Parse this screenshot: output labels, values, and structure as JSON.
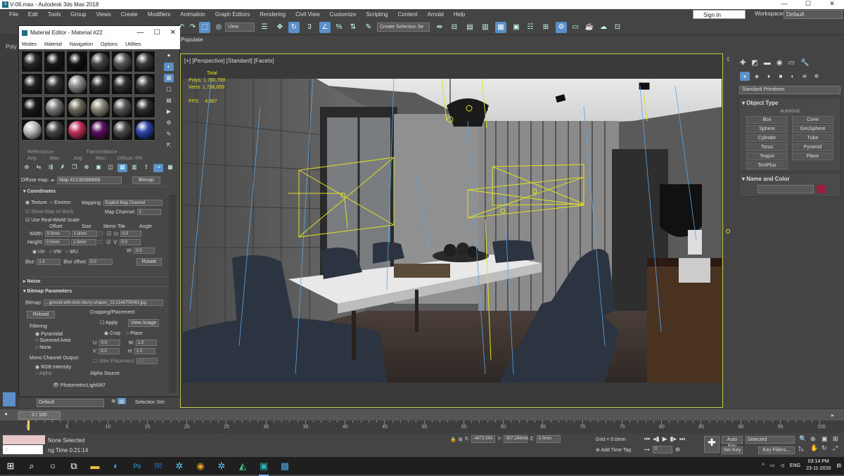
{
  "window": {
    "title": "V-06.max - Autodesk 3ds Max 2018",
    "controls": [
      "—",
      "☐",
      "✕"
    ]
  },
  "menu": [
    "File",
    "Edit",
    "Tools",
    "Group",
    "Views",
    "Create",
    "Modifiers",
    "Animation",
    "Graph Editors",
    "Rendering",
    "Civil View",
    "Customize",
    "Scripting",
    "Content",
    "Arnold",
    "Help"
  ],
  "signin": "Sign In",
  "workspaces": {
    "label": "Workspaces:",
    "value": "Default"
  },
  "toolbar": {
    "view_dropdown": "View",
    "create_selection_set": "Create Selection Se",
    "populate": "Populate"
  },
  "left": {
    "poly": "Poly"
  },
  "viewport": {
    "label": "[+] [Perspective] [Standard] [Facets]",
    "stats": {
      "total": "Total",
      "polys_label": "Polys:",
      "polys": "1,760,769",
      "verts_label": "Verts:",
      "verts": "1,738,859",
      "fps_label": "FPS:",
      "fps": "4.987"
    }
  },
  "command_panel": {
    "dropdown": "Standard Primitives",
    "object_type": {
      "title": "Object Type",
      "autogrid": "AutoGrid",
      "buttons": [
        "Box",
        "Cone",
        "Sphere",
        "GeoSphere",
        "Cylinder",
        "Tube",
        "Torus",
        "Pyramid",
        "Teapot",
        "Plane",
        "TextPlus"
      ]
    },
    "name_and_color": {
      "title": "Name and Color",
      "color": "#9b1d3a"
    }
  },
  "material_editor": {
    "title": "Material Editor - Material #22",
    "menu": [
      "Modes",
      "Material",
      "Navigation",
      "Options",
      "Utilities"
    ],
    "reflectance": "Reflectance",
    "transmittance": "Transmittance",
    "avg_label": "Avg:",
    "max_label": "Max:",
    "diffuse_label": "Diffuse:",
    "diffuse_value": "0%",
    "diffuse_map_label": "Diffuse map:",
    "diffuse_map": "Map #2138388668",
    "bitmap_button": "Bitmap",
    "coordinates": {
      "title": "Coordinates",
      "texture": "Texture",
      "environ": "Environ",
      "mapping_label": "Mapping:",
      "mapping": "Explicit Map Channel",
      "show_map": "Show Map on Back",
      "map_channel_label": "Map Channel:",
      "map_channel": "1",
      "real_world": "Use Real-World Scale",
      "offset": "Offset",
      "size": "Size",
      "mirror_tile": "Mirror Tile",
      "angle": "Angle",
      "width_label": "Width:",
      "width_offset": "0.0mm",
      "width_size": "1.0mm",
      "height_label": "Height:",
      "height_offset": "0.0mm",
      "height_size": "1.0mm",
      "u_label": "U:",
      "u_angle": "0.0",
      "v_label": "V:",
      "v_angle": "0.0",
      "w_label": "W:",
      "w_angle": "0.0",
      "uv": "UV",
      "vw": "VW",
      "wu": "WU",
      "blur_label": "Blur:",
      "blur": "1.0",
      "blur_offset_label": "Blur offset:",
      "blur_offset": "0.0",
      "rotate": "Rotate"
    },
    "noise": "Noise",
    "bitmap_params": {
      "title": "Bitmap Parameters",
      "bitmap_label": "Bitmap:",
      "bitmap_path": "...ground-with-dots-blurry-shapes_23-2148705493.jpg",
      "reload": "Reload",
      "cropping": "Cropping/Placement",
      "apply": "Apply",
      "view_image": "View Image",
      "crop": "Crop",
      "place": "Place",
      "u_label": "U:",
      "u": "0.0",
      "v_label": "V:",
      "v": "0.0",
      "w_label": "W:",
      "w": "1.0",
      "h_label": "H:",
      "h": "1.0",
      "jitter": "Jitter Placement:",
      "jitter_val": "1.0",
      "filtering": "Filtering",
      "pyramidal": "Pyramidal",
      "summed_area": "Summed Area",
      "none": "None",
      "mono_channel": "Mono Channel Output:",
      "rgb_intensity": "RGB Intensity",
      "alpha": "Alpha",
      "alpha_source": "Alpha Source"
    },
    "photometric": "PhotometricLight087",
    "slot_colors": [
      "#2a2a2a",
      "#1a1a1a",
      "#111",
      "#444",
      "#555",
      "#3a3a3a",
      "#222",
      "#333",
      "#888",
      "#2b2b2b",
      "#303030",
      "#3b3b3b",
      "#1a1a1a",
      "#777",
      "#6f6a5c",
      "#8a8578",
      "#555",
      "#2e2e2e",
      "#bbb",
      "#444",
      "#c2305a",
      "#5a1060",
      "#4a4a4a",
      "#2d44a8"
    ]
  },
  "layer": {
    "name": "Default",
    "selection_set": "Selection Set:"
  },
  "time_slider": {
    "frame": "0 / 100",
    "ticks": [
      "0",
      "5",
      "10",
      "15",
      "20",
      "25",
      "30",
      "35",
      "40",
      "45",
      "50",
      "55",
      "60",
      "65",
      "70",
      "75",
      "80",
      "85",
      "90",
      "95",
      "100"
    ]
  },
  "status": {
    "selection": "None Selected",
    "render_time": "ng Time  0:21:14",
    "x_label": "X:",
    "x": "-4672.554",
    "y_label": "Y:",
    "y": "357.294mm",
    "z_label": "Z:",
    "z": "0.0mm",
    "grid": "Grid = 0.0mm",
    "add_time_tag": "Add Time Tag",
    "auto_key": "Auto Key",
    "set_key": "Set Key",
    "selected": "Selected",
    "key_filters": "Key Filters...",
    "frame": "0"
  },
  "taskbar": {
    "lang": "ENG",
    "time": "03:14 PM",
    "date": "23-11-2020"
  }
}
